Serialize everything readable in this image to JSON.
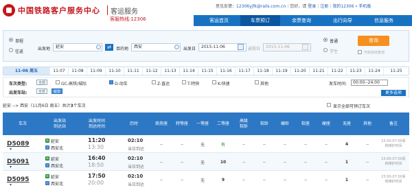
{
  "header": {
    "logo_text": "中国铁路客户服务中心",
    "logo_sub": "客运服务",
    "hotline": "客服热线:12306",
    "opinion_label": "意见反馈：",
    "opinion_email": "12306yjfk@rails.com.cn",
    "hello": "您好，请",
    "login": "登录",
    "register": "注册",
    "my12306": "我的12306",
    "mobile": "手机版"
  },
  "nav": [
    {
      "label": "客运首页"
    },
    {
      "label": "车票预订"
    },
    {
      "label": "余票查询"
    },
    {
      "label": "出行向导"
    },
    {
      "label": "信息服务"
    }
  ],
  "search": {
    "oneway": "单程",
    "roundtrip": "往返",
    "from_label": "出发地",
    "from_value": "延安",
    "to_label": "目的地",
    "to_value": "西安",
    "depart_label": "出发日",
    "depart_value": "2015-11-06",
    "return_label": "返程日",
    "return_value": "2015-11-06",
    "normal": "普通",
    "student": "学生",
    "query": "查询",
    "refresh": "开启自动查询",
    "swap_icon": "⇄"
  },
  "dates": [
    "11-06 周五",
    "11-07",
    "11-08",
    "11-09",
    "11-10",
    "11-11",
    "11-12",
    "11-13",
    "11-14",
    "11-15",
    "11-16",
    "11-17",
    "11-18",
    "11-19",
    "11-20",
    "11-21",
    "11-22",
    "11-23",
    "11-24",
    "11-25"
  ],
  "filters": {
    "type_label": "车次类型:",
    "all": "全部",
    "types": [
      "GC-高铁/城际",
      "D-动车",
      "Z-直达",
      "T-特快",
      "K-快速",
      "其他"
    ],
    "type_checked": [
      false,
      true,
      false,
      false,
      false,
      false
    ],
    "station_label": "出发车站:",
    "stations": [
      "延安"
    ],
    "time_label": "发车时间:",
    "time_value": "00:00--24:00",
    "more": "更多选项"
  },
  "summary": {
    "route": "延安 --> 西安（11月6日 周五）共计",
    "count": "3",
    "suffix": "个车次",
    "show_all": "显示全部可预订车次"
  },
  "columns": [
    "车次",
    "出发站\n到达站",
    "出发时间\n到达时间",
    "历时",
    "商务座",
    "特等座",
    "一等座",
    "二等座",
    "高级\n软卧",
    "软卧",
    "硬卧",
    "软座",
    "硬座",
    "无座",
    "其他",
    "备注"
  ],
  "rows": [
    {
      "train": "D5089",
      "from": "延安",
      "to": "西安北",
      "dep": "11:20",
      "arr": "13:30",
      "dur": "02:10",
      "day": "当日到达",
      "seats": [
        "--",
        "--",
        "无",
        "有",
        "--",
        "--",
        "--",
        "--",
        "--",
        "4",
        "--"
      ],
      "note": "23:00-07:00系\n统维护时间"
    },
    {
      "train": "D5091",
      "from": "延安",
      "to": "西安北",
      "dep": "16:40",
      "arr": "18:50",
      "dur": "02:10",
      "day": "当日到达",
      "seats": [
        "--",
        "--",
        "无",
        "10",
        "--",
        "--",
        "--",
        "--",
        "--",
        "1",
        "--"
      ],
      "note": "23:00-07:00系\n统维护时间"
    },
    {
      "train": "D5095",
      "from": "延安",
      "to": "西安北",
      "dep": "17:50",
      "arr": "20:00",
      "dur": "02:10",
      "day": "当日到达",
      "seats": [
        "--",
        "--",
        "无",
        "9",
        "--",
        "--",
        "--",
        "--",
        "--",
        "1",
        "--"
      ],
      "note": "23:00-07:00系\n统维护时间"
    }
  ],
  "colors": {
    "brand_red": "#c4161c",
    "nav_blue": "#1872c2",
    "orange": "#f68f1e"
  }
}
